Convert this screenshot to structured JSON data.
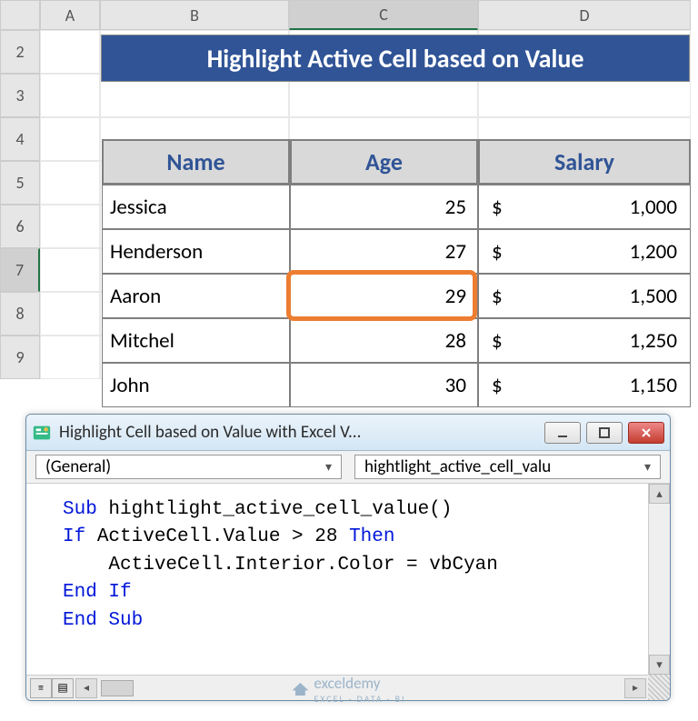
{
  "columns": [
    "A",
    "B",
    "C",
    "D"
  ],
  "rowLabels": [
    "2",
    "3",
    "4",
    "5",
    "6",
    "7",
    "8",
    "9"
  ],
  "activeCol": "C",
  "activeRow": "7",
  "banner": {
    "title": "Highlight Active Cell based on Value"
  },
  "table": {
    "headers": {
      "name": "Name",
      "age": "Age",
      "salary": "Salary"
    },
    "rows": [
      {
        "name": "Jessica",
        "age": "25",
        "cur": "$",
        "salary": "1,000"
      },
      {
        "name": "Henderson",
        "age": "27",
        "cur": "$",
        "salary": "1,200"
      },
      {
        "name": "Aaron",
        "age": "29",
        "cur": "$",
        "salary": "1,500"
      },
      {
        "name": "Mitchel",
        "age": "28",
        "cur": "$",
        "salary": "1,250"
      },
      {
        "name": "John",
        "age": "30",
        "cur": "$",
        "salary": "1,150"
      }
    ]
  },
  "vba": {
    "title": "Highlight Cell based on Value with Excel V...",
    "dropdown1": "(General)",
    "dropdown2": "hightlight_active_cell_valu",
    "code": {
      "l1a": "Sub",
      "l1b": " hightlight_active_cell_value()",
      "l2a": "If",
      "l2b": " ActiveCell.Value > 28 ",
      "l2c": "Then",
      "l3": "    ActiveCell.Interior.Color = vbCyan",
      "l4": "End If",
      "l5": "End Sub"
    }
  },
  "watermark": {
    "brand": "exceldemy",
    "tag": "EXCEL · DATA · BI"
  }
}
